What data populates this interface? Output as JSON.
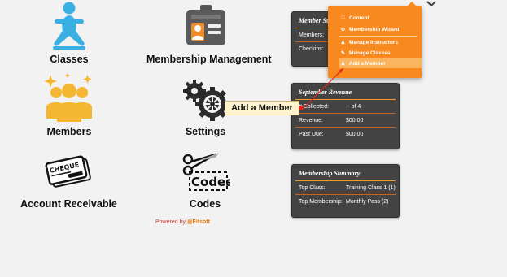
{
  "tiles": {
    "classes": "Classes",
    "membership_management": "Membership Management",
    "members": "Members",
    "settings": "Settings",
    "account_receivable": "Account Receivable",
    "codes": "Codes",
    "cheque_text": "CHEQUE",
    "codes_icon_text": "Codes"
  },
  "panels": {
    "summary_partial": {
      "title": "Member Su",
      "rows": [
        {
          "k": "Members:",
          "v": ""
        },
        {
          "k": "Checkins:",
          "v": ""
        }
      ]
    },
    "revenue": {
      "title": "September Revenue",
      "rows": [
        {
          "k": "# Collected:",
          "v": "-- of 4"
        },
        {
          "k": "Revenue:",
          "v": "$00.00"
        },
        {
          "k": "Past Due:",
          "v": "$00.00"
        }
      ]
    },
    "membership_summary": {
      "title": "Membership Summary",
      "rows": [
        {
          "k": "Top Class:",
          "v": "Training Class 1 (1)"
        },
        {
          "k": "Top Membership:",
          "v": "Monthly Pass (2)"
        }
      ]
    }
  },
  "dropdown": {
    "items": [
      {
        "label": "Content",
        "icon": "document-icon"
      },
      {
        "label": "Membership Wizard",
        "icon": "gear-icon"
      },
      {
        "label": "Manage Instructors",
        "icon": "person-icon"
      },
      {
        "label": "Manage Classes",
        "icon": "pencil-icon"
      },
      {
        "label": "Add a Member",
        "icon": "person-icon"
      }
    ],
    "active_index": 4
  },
  "tooltip": "Add a Member",
  "footer": {
    "powered_by": "Powered by",
    "brand": "Fitsoft"
  },
  "colors": {
    "accent": "#f7891f",
    "panel_bg": "#434343",
    "icon_blue": "#3ab0e2",
    "icon_yellow": "#f5b731"
  }
}
